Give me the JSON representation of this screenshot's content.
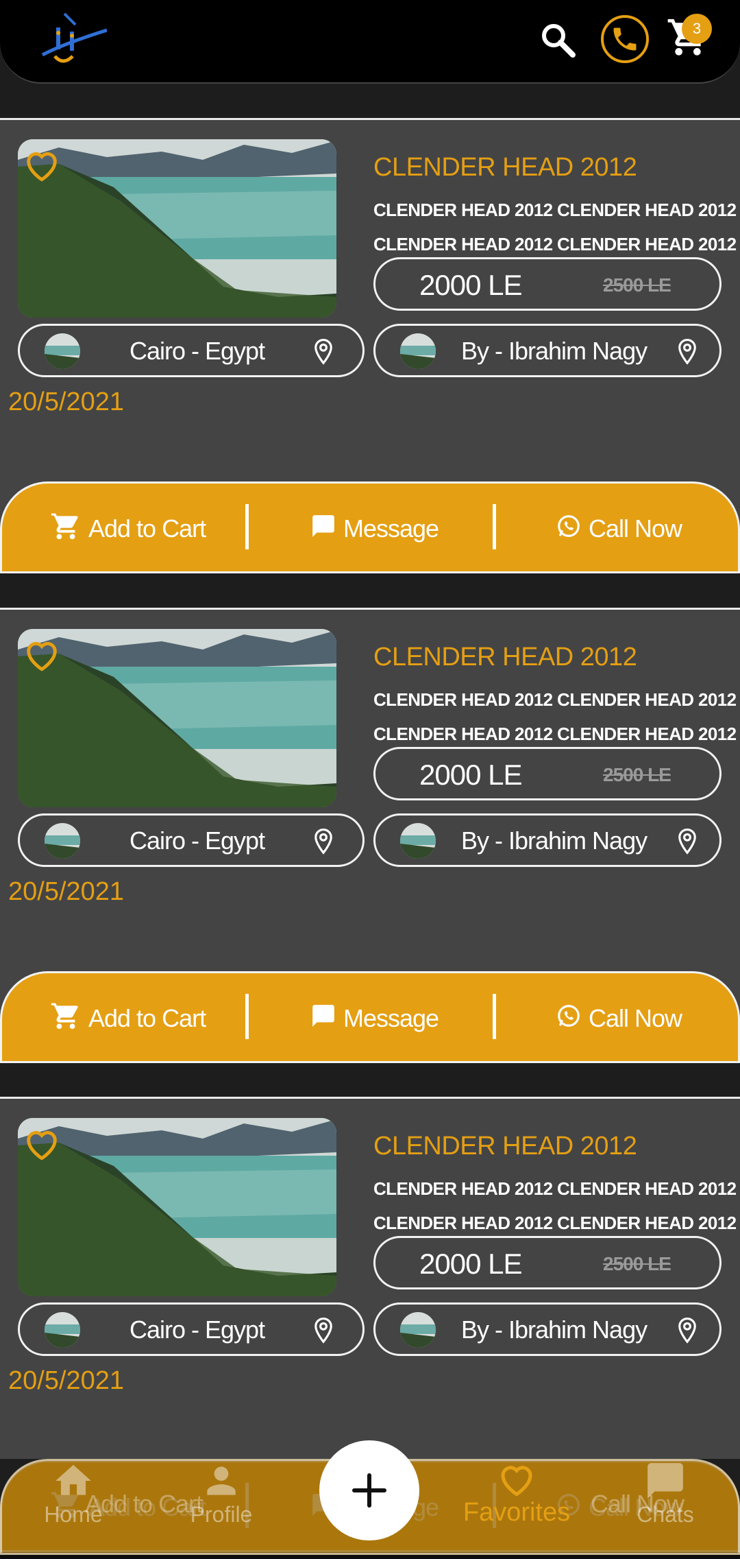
{
  "header": {
    "cart_count": "3",
    "accent": "#e49f13"
  },
  "cards": [
    {
      "title": "CLENDER HEAD 2012",
      "desc1": "CLENDER HEAD 2012 CLENDER HEAD 2012",
      "desc2": "CLENDER HEAD 2012 CLENDER HEAD 2012",
      "price": "2000 LE",
      "old_price": "2500 LE",
      "location": "Cairo - Egypt",
      "seller": "By - Ibrahim Nagy",
      "date": "20/5/2021",
      "actions": {
        "cart": "Add to Cart",
        "message": "Message",
        "call": "Call Now"
      }
    },
    {
      "title": "CLENDER HEAD 2012",
      "desc1": "CLENDER HEAD 2012 CLENDER HEAD 2012",
      "desc2": "CLENDER HEAD 2012 CLENDER HEAD 2012",
      "price": "2000 LE",
      "old_price": "2500 LE",
      "location": "Cairo - Egypt",
      "seller": "By - Ibrahim Nagy",
      "date": "20/5/2021",
      "actions": {
        "cart": "Add to Cart",
        "message": "Message",
        "call": "Call Now"
      }
    },
    {
      "title": "CLENDER HEAD 2012",
      "desc1": "CLENDER HEAD 2012 CLENDER HEAD 2012",
      "desc2": "CLENDER HEAD 2012 CLENDER HEAD 2012",
      "price": "2000 LE",
      "old_price": "2500 LE",
      "location": "Cairo - Egypt",
      "seller": "By - Ibrahim Nagy",
      "date": "20/5/2021",
      "actions": {
        "cart": "Add to Cart",
        "message": "Message",
        "call": "Call Now"
      }
    }
  ],
  "bottom_nav": {
    "home": "Home",
    "profile": "Profile",
    "favorites": "Favorites",
    "chats": "Chats"
  },
  "ghost_actions": {
    "cart": "Add to Cart",
    "message": "ge",
    "call": "Call Now"
  }
}
